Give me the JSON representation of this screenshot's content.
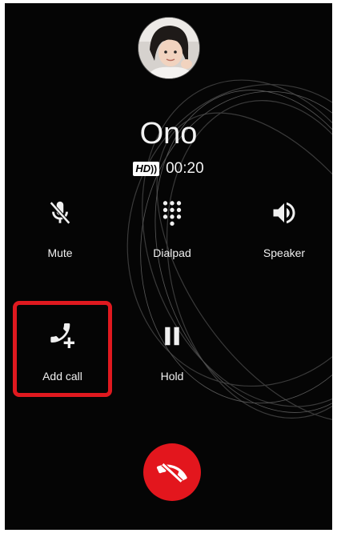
{
  "caller": {
    "name": "Ono",
    "hd_badge": "HD",
    "duration": "00:20"
  },
  "controls": [
    {
      "label": "Mute",
      "icon": "mic-off-icon"
    },
    {
      "label": "Dialpad",
      "icon": "dialpad-icon"
    },
    {
      "label": "Speaker",
      "icon": "speaker-icon"
    },
    {
      "label": "Add call",
      "icon": "add-call-icon"
    },
    {
      "label": "Hold",
      "icon": "pause-icon"
    }
  ],
  "end_call": {
    "icon": "end-call-icon"
  },
  "colors": {
    "background": "#050505",
    "highlight": "#e0191f",
    "end_call": "#e3161d",
    "text": "#f2f2f2"
  }
}
